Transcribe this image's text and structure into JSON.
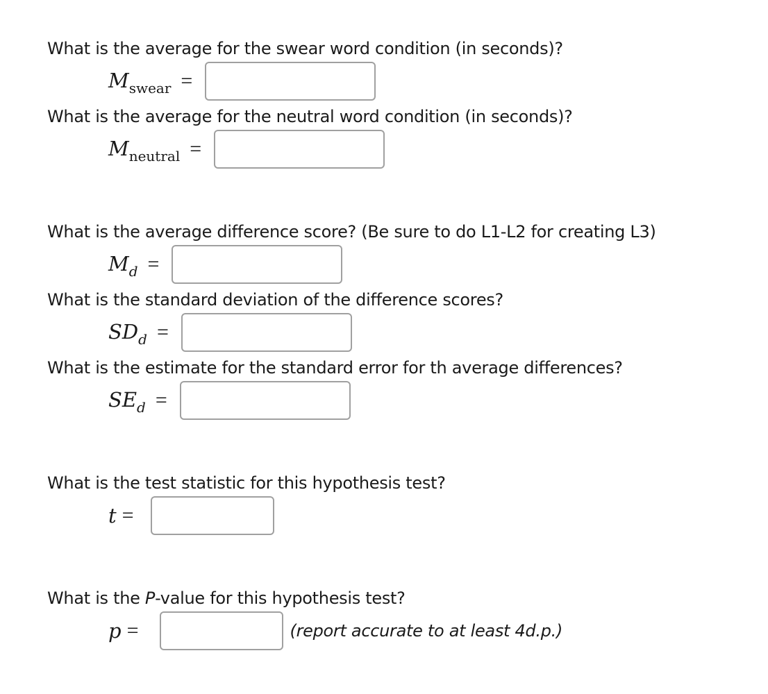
{
  "questions": [
    {
      "id": "m_swear",
      "prompt": "What is the average for the swear word condition (in seconds)?",
      "symbol": "M",
      "subscript": "swear",
      "equals": "=",
      "value": ""
    },
    {
      "id": "m_neutral",
      "prompt": "What is the average for the neutral word condition (in seconds)?",
      "symbol": "M",
      "subscript": "neutral",
      "equals": "=",
      "value": ""
    },
    {
      "id": "m_d",
      "prompt": "What is the average difference score? (Be sure to do L1-L2 for creating L3)",
      "symbol": "M",
      "subscript": "d",
      "equals": "=",
      "value": ""
    },
    {
      "id": "sd_d",
      "prompt": "What is the standard deviation of the difference scores?",
      "symbol": "SD",
      "subscript": "d",
      "equals": "=",
      "value": ""
    },
    {
      "id": "se_d",
      "prompt": "What is the estimate for the standard error for th average differences?",
      "symbol": "SE",
      "subscript": "d",
      "equals": "=",
      "value": ""
    },
    {
      "id": "t",
      "prompt": "What is the test statistic for this hypothesis test?",
      "symbol": "t",
      "subscript": "",
      "equals": "=",
      "value": ""
    },
    {
      "id": "p",
      "prompt_before": "What is the ",
      "prompt_italic": "P",
      "prompt_after": "-value for this hypothesis test?",
      "symbol": "p",
      "subscript": "",
      "equals": "=",
      "value": "",
      "note": "(report accurate to at least 4d.p.)"
    }
  ]
}
